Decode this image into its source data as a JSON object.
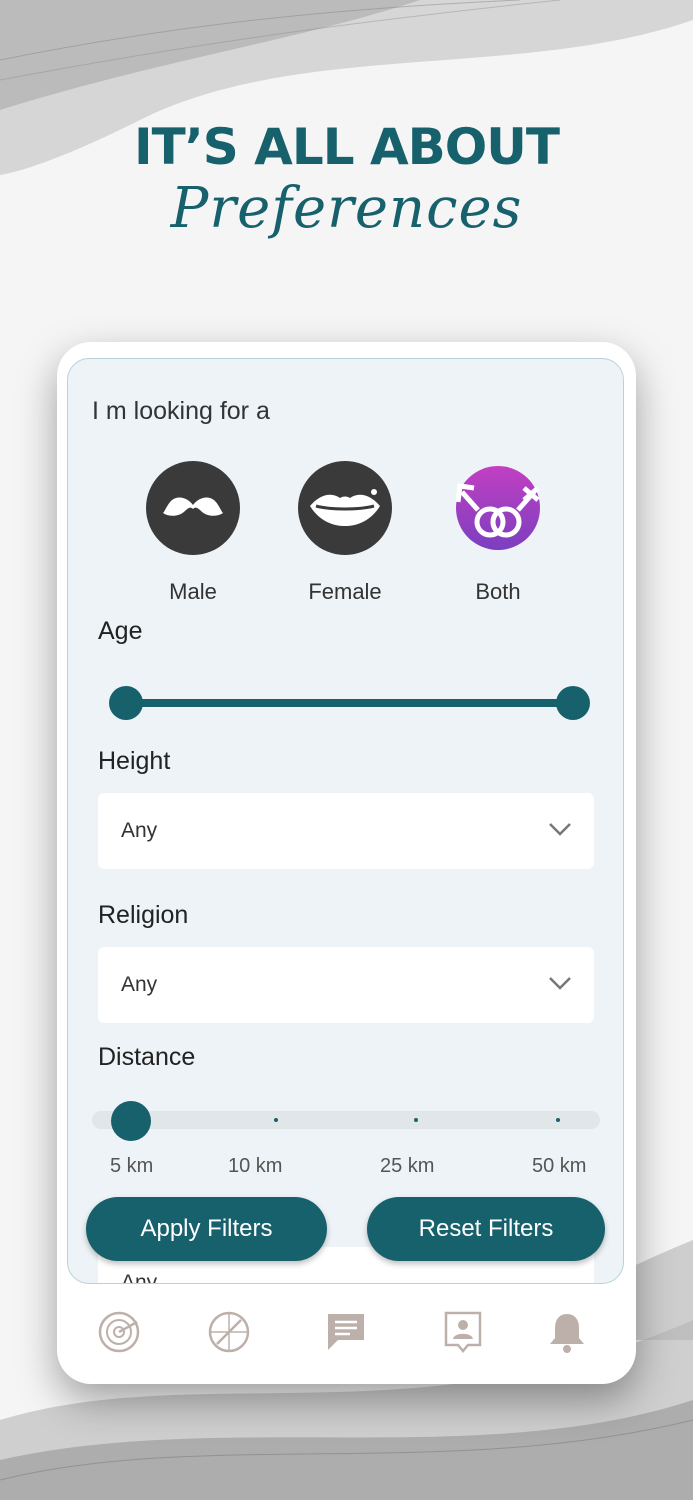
{
  "headline": "IT’S ALL ABOUT",
  "script_word": "Preferences",
  "looking_for": "I m looking for a",
  "genders": [
    {
      "label": "Male",
      "icon": "mustache-icon"
    },
    {
      "label": "Female",
      "icon": "lips-icon"
    },
    {
      "label": "Both",
      "icon": "gender-symbols-icon"
    }
  ],
  "age": {
    "label": "Age",
    "range_fraction": [
      0.0,
      1.0
    ]
  },
  "height": {
    "label": "Height",
    "value": "Any"
  },
  "religion": {
    "label": "Religion",
    "value": "Any"
  },
  "distance": {
    "label": "Distance",
    "options": [
      "5 km",
      "10 km",
      "25 km",
      "50 km"
    ],
    "selected": "5 km"
  },
  "peek_value": "Any",
  "buttons": {
    "apply": "Apply Filters",
    "reset": "Reset Filters"
  },
  "nav": [
    "radar-icon",
    "compass-icon",
    "chat-icon",
    "profile-card-icon",
    "bell-icon"
  ],
  "colors": {
    "accent": "#17616c",
    "panel": "#edf3f6",
    "both_gradient": [
      "#c23fc2",
      "#7b3fc0"
    ]
  }
}
